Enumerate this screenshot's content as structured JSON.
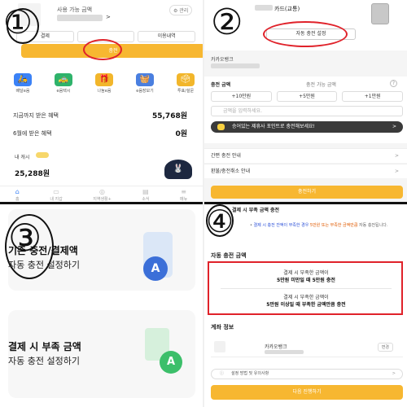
{
  "q1": {
    "mark": "①",
    "available_label": "사용 가능 금액",
    "manage_label": "⚙ 관리",
    "caret": ">",
    "buttons": [
      "결제",
      "",
      "이용내역"
    ],
    "charge_label": "충전",
    "icons": [
      {
        "label": "배달e음",
        "icon": "delivery-icon",
        "color": "#3b82f6",
        "glyph": "🛵"
      },
      {
        "label": "e음택시",
        "icon": "taxi-icon",
        "color": "#2fb36b",
        "glyph": "🚕"
      },
      {
        "label": "나눔e음",
        "icon": "gift-icon",
        "color": "#f2b62b",
        "glyph": "🎁"
      },
      {
        "label": "e음장보기",
        "icon": "basket-icon",
        "color": "#4a7fe0",
        "glyph": "🧺"
      },
      {
        "label": "투표/설문",
        "icon": "vote-icon",
        "color": "#f2b62b",
        "glyph": "🗳"
      }
    ],
    "benefit_total_label": "지금까지 받은 혜택",
    "benefit_total_value": "55,768원",
    "benefit_june_label": "6월에 받은 혜택",
    "benefit_june_value": "0원",
    "cash_label": "내 캐시",
    "cash_value": "25,288원",
    "tabs": [
      {
        "label": "홈",
        "icon": "home-icon",
        "glyph": "⌂"
      },
      {
        "label": "내 지갑",
        "icon": "wallet-icon",
        "glyph": "▭"
      },
      {
        "label": "지역생활+",
        "icon": "local-icon",
        "glyph": "◎"
      },
      {
        "label": "소식",
        "icon": "news-icon",
        "glyph": "▤"
      },
      {
        "label": "메뉴",
        "icon": "menu-icon",
        "glyph": "≡"
      }
    ]
  },
  "q2": {
    "mark": "②",
    "card_title": "카드(교통)",
    "auto_charge_button": "자동 충전 설정",
    "bank_name": "카카오뱅크",
    "charge_amount_label": "충전 금액",
    "charge_available_label": "충전 가능 금액",
    "amount_buttons": [
      "+10만원",
      "+5만원",
      "+1만원"
    ],
    "amount_placeholder": "금액을 입력하세요.",
    "notice_text": "승어있는 제휴사 포인트로 충전해보세요!",
    "menu_rows": [
      "간편 충전 안내",
      "환불/충전취소 안내"
    ],
    "charge_button": "충전하기"
  },
  "q3": {
    "mark": "③",
    "card1_title": "기존 충전/결제액",
    "card1_sub": "자동 충전 설정하기",
    "card1_badge": "A",
    "card2_title": "결제 시 부족 금액",
    "card2_sub": "자동 충전 설정하기",
    "card2_badge": "A"
  },
  "q4": {
    "mark": "④",
    "heading": "결제 시 부족 금액 충전",
    "note_lead": "결제 시 충전 잔액이 부족한 경우",
    "note_em": "5만원 또는 부족한 금액만큼",
    "note_tail": "자동 충전됩니다.",
    "auto_charge_heading": "자동 충전 금액",
    "option1_line1": "결제 시 부족한 금액이",
    "option1_line2": "5만원 미만일 때 5만원 충전",
    "option2_line1": "결제 시 부족한 금액이",
    "option2_line2": "5만원 이상일 때 부족한 금액만큼 충전",
    "account_heading": "계좌 정보",
    "account_bank": "카카오뱅크",
    "change_label": "변경",
    "settings_text": "설정 방법 및 유의사항",
    "next_button": "다음 진행하기"
  }
}
